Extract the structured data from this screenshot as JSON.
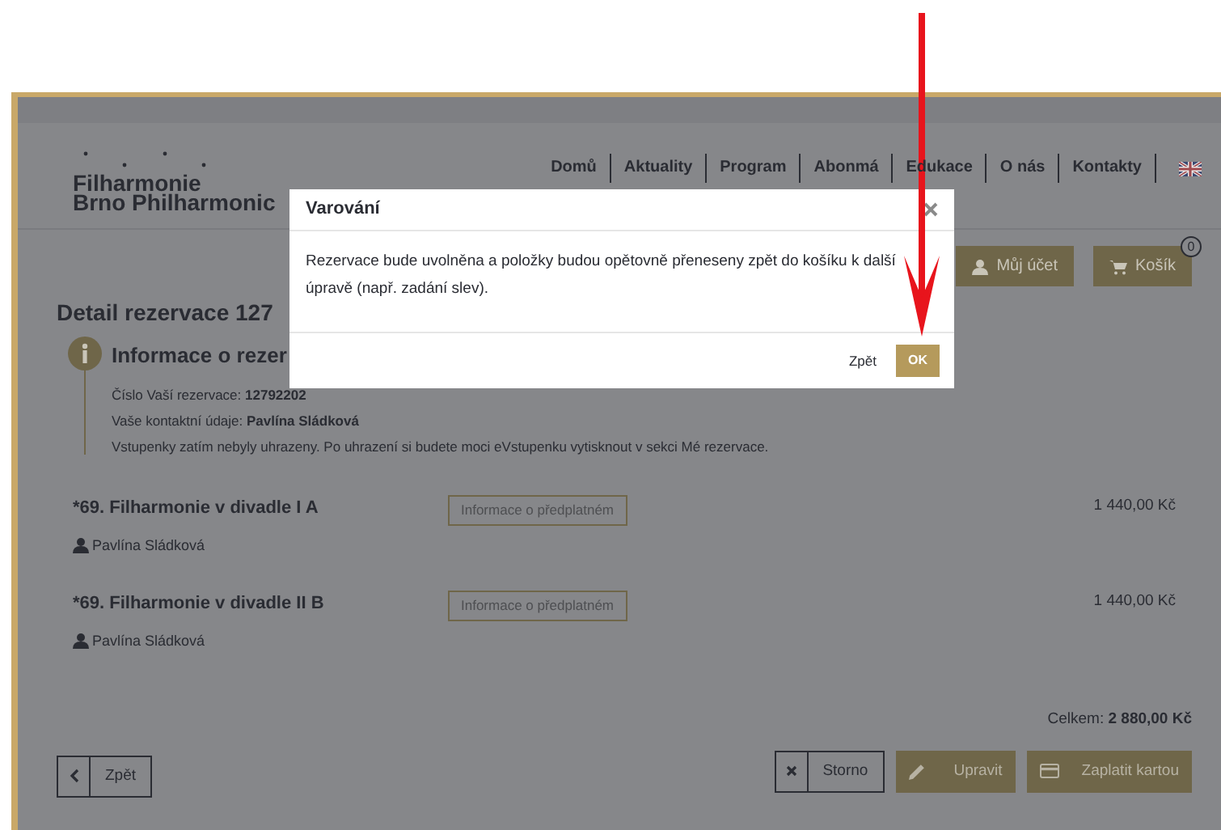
{
  "header": {
    "logo": [
      "Filharmonie",
      "Brno Philharmonic"
    ],
    "nav": [
      "Domů",
      "Aktuality",
      "Program",
      "Abonmá",
      "Edukace",
      "O nás",
      "Kontakty"
    ],
    "account_button": "Můj účet",
    "cart_button": "Košík",
    "cart_count": "0"
  },
  "page": {
    "title": "Detail rezervace 127",
    "info": {
      "heading": "Informace o rezer",
      "lines": [
        "Číslo Vaší rezervace: **12792202**",
        "Vaše kontaktní údaje: **Pavlína Sládková**",
        "Vstupenky zatím nebyly uhrazeny. Po uhrazení si budete moci eVstupenku vytisknout v sekci Mé rezervace."
      ]
    },
    "items": [
      {
        "title": "*69. Filharmonie v divadle I A",
        "info_button": "Informace o předplatném",
        "price": "1 440,00 Kč",
        "person": "Pavlína Sládková"
      },
      {
        "title": "*69. Filharmonie v divadle II B",
        "info_button": "Informace o předplatném",
        "price": "1 440,00 Kč",
        "person": "Pavlína Sládková"
      }
    ],
    "total": "Celkem: **2 880,00 Kč**",
    "buttons": {
      "back": "Zpět",
      "cancel": "Storno",
      "edit": "Upravit",
      "pay": "Zaplatit kartou"
    }
  },
  "dialog": {
    "title": "Varování",
    "message": "Rezervace bude uvolněna a položky budou opětovně přeneseny zpět do košíku k další úpravě (např. zadání slev).",
    "cancel": "Zpět",
    "confirm": "OK"
  }
}
